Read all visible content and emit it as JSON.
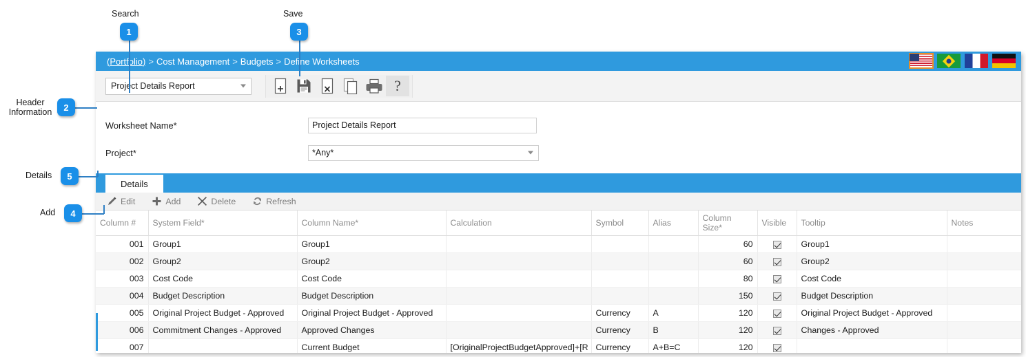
{
  "annotations": [
    {
      "num": "1",
      "label": "Search"
    },
    {
      "num": "3",
      "label": "Save"
    },
    {
      "num": "2",
      "label_line1": "Header",
      "label_line2": "Information"
    },
    {
      "num": "5",
      "label": "Details"
    },
    {
      "num": "4",
      "label": "Add"
    }
  ],
  "breadcrumb": {
    "portfolio": "(Portfolio)",
    "sep": ">",
    "item2": "Cost Management",
    "item3": "Budgets",
    "item4": "Define Worksheets"
  },
  "flags": [
    {
      "name": "united-states",
      "selected": true
    },
    {
      "name": "brazil",
      "selected": false
    },
    {
      "name": "france",
      "selected": false
    },
    {
      "name": "germany",
      "selected": false
    }
  ],
  "toolbar": {
    "worksheet_combo_value": "Project Details Report",
    "buttons": [
      {
        "name": "new-icon",
        "title": "New"
      },
      {
        "name": "save-icon",
        "title": "Save"
      },
      {
        "name": "delete-icon",
        "title": "Delete"
      },
      {
        "name": "copy-icon",
        "title": "Copy"
      },
      {
        "name": "print-icon",
        "title": "Print"
      },
      {
        "name": "help-icon",
        "title": "Help",
        "highlighted": true
      }
    ]
  },
  "form": {
    "worksheet_name_label": "Worksheet Name*",
    "worksheet_name_value": "Project Details Report",
    "project_label": "Project*",
    "project_value": "*Any*"
  },
  "details": {
    "tab_label": "Details",
    "actions": [
      {
        "name": "edit",
        "label": "Edit",
        "icon": "pencil-icon"
      },
      {
        "name": "add",
        "label": "Add",
        "icon": "plus-icon"
      },
      {
        "name": "delete",
        "label": "Delete",
        "icon": "x-icon"
      },
      {
        "name": "refresh",
        "label": "Refresh",
        "icon": "refresh-icon"
      }
    ]
  },
  "table": {
    "columns": [
      "Column #",
      "System Field*",
      "Column Name*",
      "Calculation",
      "Symbol",
      "Alias",
      "Column Size*",
      "Visible",
      "Tooltip",
      "Notes"
    ],
    "rows": [
      {
        "col": "001",
        "system_field": "Group1",
        "column_name": "Group1",
        "calculation": "",
        "symbol": "",
        "alias": "",
        "size": "60",
        "visible": true,
        "tooltip": "Group1",
        "notes": ""
      },
      {
        "col": "002",
        "system_field": "Group2",
        "column_name": "Group2",
        "calculation": "",
        "symbol": "",
        "alias": "",
        "size": "60",
        "visible": true,
        "tooltip": "Group2",
        "notes": ""
      },
      {
        "col": "003",
        "system_field": "Cost Code",
        "column_name": "Cost Code",
        "calculation": "",
        "symbol": "",
        "alias": "",
        "size": "80",
        "visible": true,
        "tooltip": "Cost Code",
        "notes": ""
      },
      {
        "col": "004",
        "system_field": "Budget Description",
        "column_name": "Budget Description",
        "calculation": "",
        "symbol": "",
        "alias": "",
        "size": "150",
        "visible": true,
        "tooltip": "Budget Description",
        "notes": ""
      },
      {
        "col": "005",
        "system_field": "Original Project Budget - Approved",
        "column_name": "Original Project Budget - Approved",
        "calculation": "",
        "symbol": "Currency",
        "alias": "A",
        "size": "120",
        "visible": true,
        "tooltip": "Original Project Budget - Approved",
        "notes": ""
      },
      {
        "col": "006",
        "system_field": "Commitment Changes - Approved",
        "column_name": "Approved Changes",
        "calculation": "",
        "symbol": "Currency",
        "alias": "B",
        "size": "120",
        "visible": true,
        "tooltip": "Changes - Approved",
        "notes": ""
      },
      {
        "col": "007",
        "system_field": "",
        "column_name": "Current Budget",
        "calculation": "[OriginalProjectBudgetApproved]+[R",
        "symbol": "Currency",
        "alias": "A+B=C",
        "size": "120",
        "visible": true,
        "tooltip": "",
        "notes": ""
      }
    ]
  },
  "colors": {
    "header_blue": "#2f9ade",
    "callout_blue": "#1a8fe8",
    "leader_line": "#2e7fc4"
  }
}
